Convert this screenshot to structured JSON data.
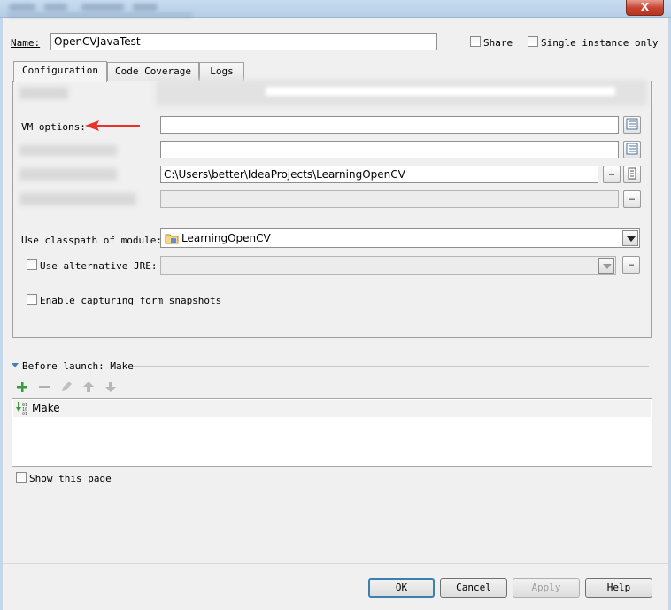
{
  "window": {
    "close_label": "X"
  },
  "header": {
    "name_label": "Name:",
    "name_value": "OpenCVJavaTest",
    "share_label": "Share",
    "single_instance_label": "Single instance only"
  },
  "tabs": [
    {
      "label": "Configuration"
    },
    {
      "label": "Code Coverage"
    },
    {
      "label": "Logs"
    }
  ],
  "config": {
    "vm_options_label": "VM options:",
    "vm_options_value": "",
    "program_args_value": "",
    "working_dir_value": "C:\\Users\\better\\IdeaProjects\\LearningOpenCV",
    "env_value": "",
    "classpath_label": "Use classpath of module:",
    "classpath_value": "LearningOpenCV",
    "alt_jre_label": "Use alternative JRE:",
    "alt_jre_value": "",
    "snapshots_label": "Enable capturing form snapshots"
  },
  "before_launch": {
    "header_label": "Before launch: Make",
    "items": [
      {
        "label": "Make"
      }
    ],
    "show_page_label": "Show this page"
  },
  "footer": {
    "ok_label": "OK",
    "cancel_label": "Cancel",
    "apply_label": "Apply",
    "help_label": "Help"
  },
  "colors": {
    "arrow_annotation": "#e8322c",
    "add_icon": "#3a9a3a",
    "make_icon": "#3a9a3a"
  }
}
